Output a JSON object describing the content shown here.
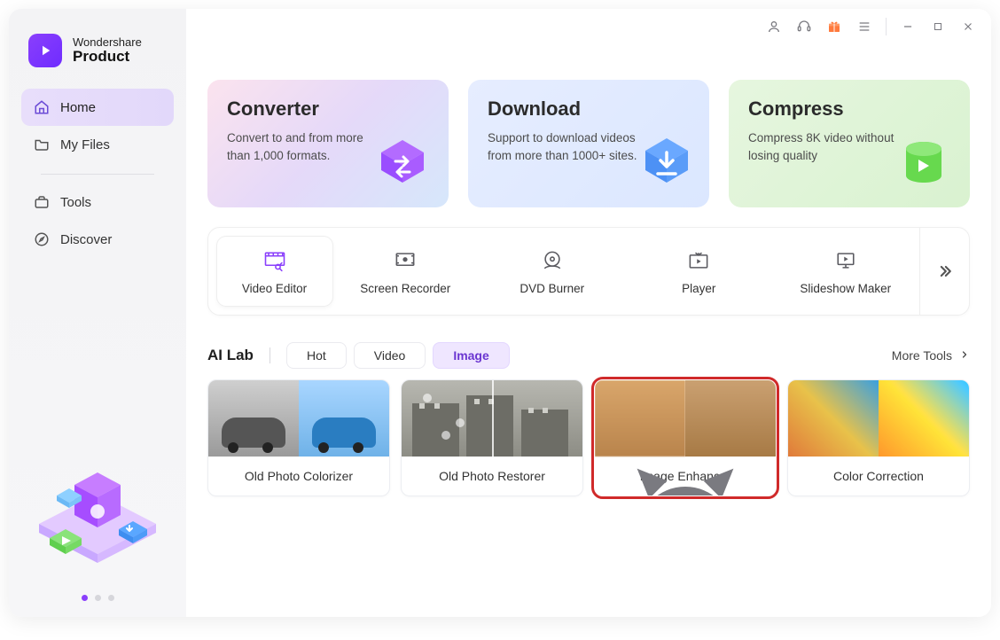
{
  "brand": {
    "top": "Wondershare",
    "bottom": "Product"
  },
  "sidebar": {
    "items": [
      {
        "label": "Home"
      },
      {
        "label": "My Files"
      },
      {
        "label": "Tools"
      },
      {
        "label": "Discover"
      }
    ]
  },
  "cards": {
    "converter": {
      "title": "Converter",
      "desc": "Convert to and from more than 1,000 formats."
    },
    "download": {
      "title": "Download",
      "desc": "Support to download videos from more than 1000+ sites."
    },
    "compress": {
      "title": "Compress",
      "desc": "Compress 8K video without losing quality"
    }
  },
  "tools": {
    "items": [
      {
        "label": "Video Editor"
      },
      {
        "label": "Screen Recorder"
      },
      {
        "label": "DVD Burner"
      },
      {
        "label": "Player"
      },
      {
        "label": "Slideshow Maker"
      }
    ]
  },
  "ailab": {
    "title": "AI Lab",
    "tabs": [
      {
        "label": "Hot"
      },
      {
        "label": "Video"
      },
      {
        "label": "Image"
      }
    ],
    "more": "More Tools",
    "cards": [
      {
        "label": "Old Photo Colorizer"
      },
      {
        "label": "Old Photo Restorer"
      },
      {
        "label": "Image Enhancer"
      },
      {
        "label": "Color Correction"
      }
    ]
  }
}
